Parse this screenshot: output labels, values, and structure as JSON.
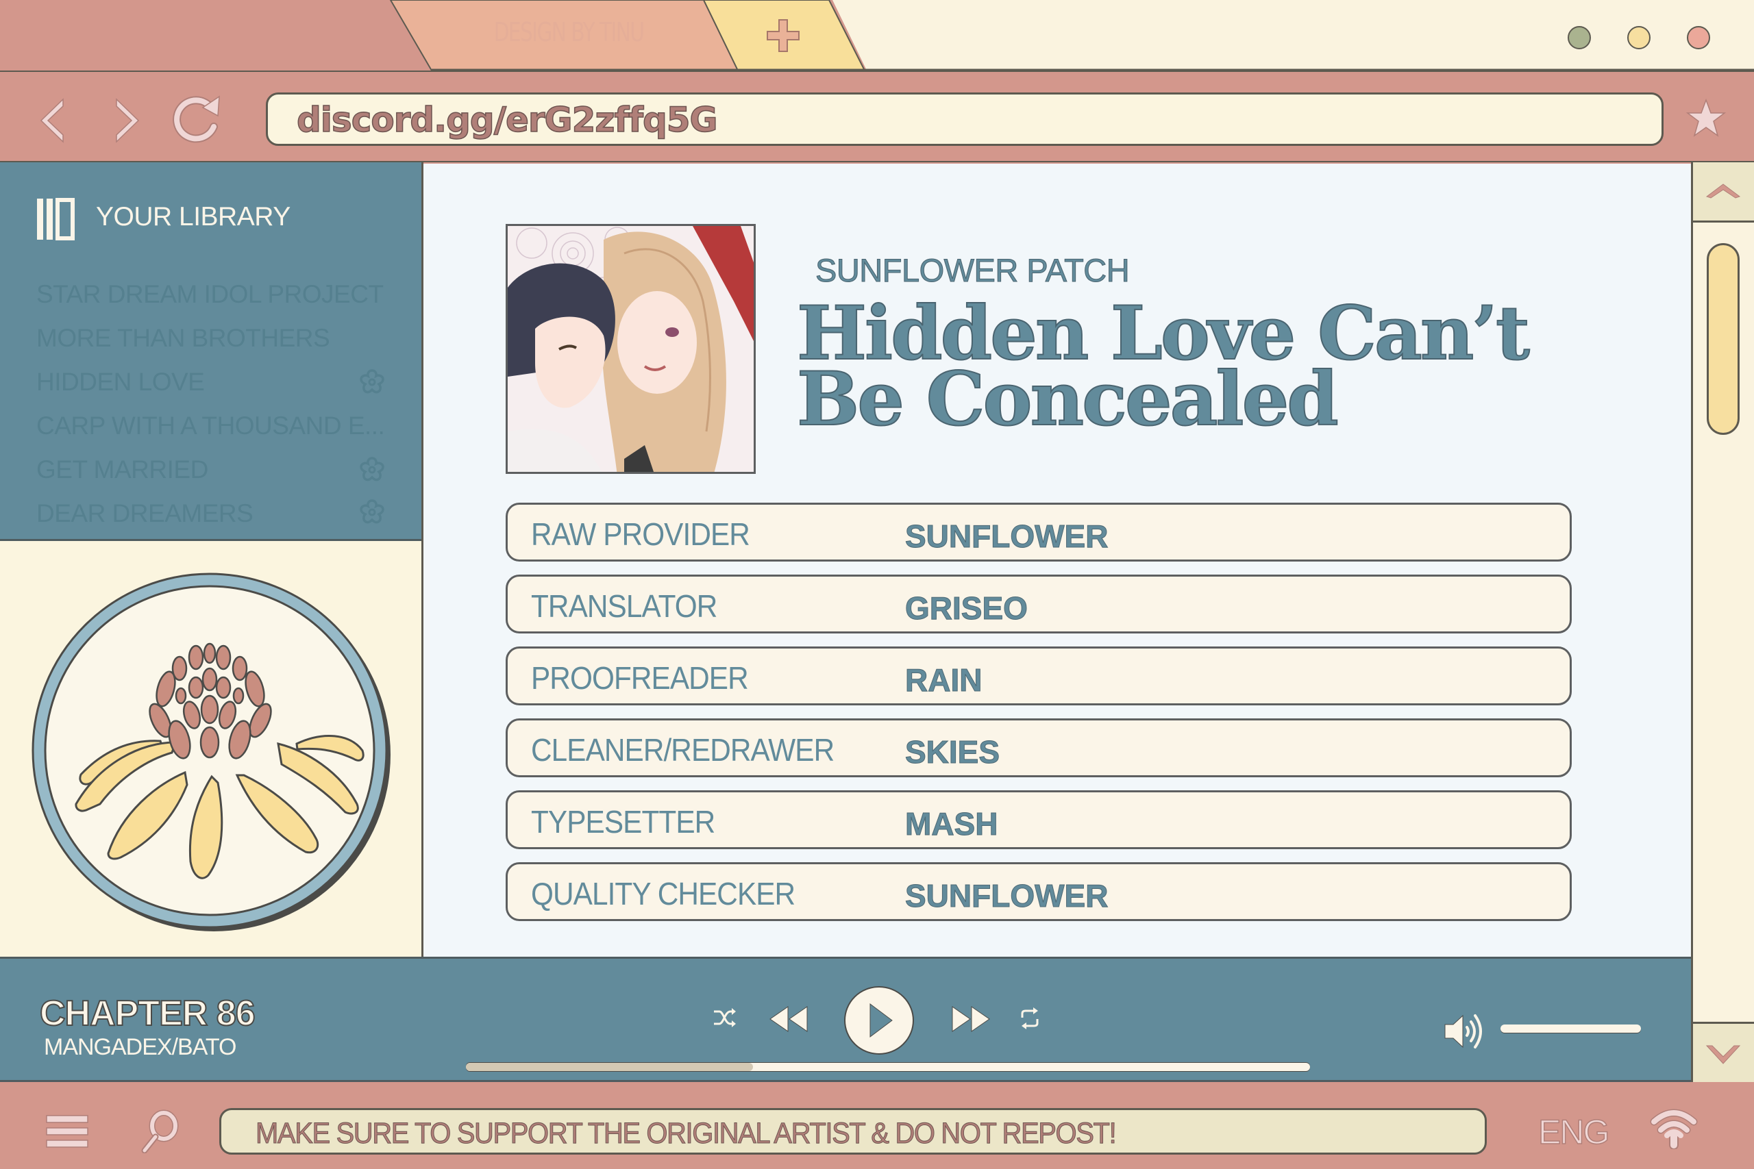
{
  "browser": {
    "tab_label": "DESIGN BY TINU",
    "new_tab_icon": "plus-icon",
    "window_dots": [
      {
        "name": "minimize",
        "color": "#aab38f"
      },
      {
        "name": "maximize",
        "color": "#f7dfa0"
      },
      {
        "name": "close",
        "color": "#eba89a"
      }
    ],
    "nav": {
      "back_icon": "chevron-left-icon",
      "forward_icon": "chevron-right-icon",
      "reload_icon": "reload-icon",
      "bookmark_icon": "star-icon"
    },
    "url": "discord.gg/erG2zffq5G"
  },
  "sidebar": {
    "title": "YOUR LIBRARY",
    "items": [
      {
        "label": "STAR DREAM IDOL PROJECT",
        "flower": false
      },
      {
        "label": "MORE THAN BROTHERS",
        "flower": false
      },
      {
        "label": "HIDDEN LOVE",
        "flower": true
      },
      {
        "label": "CARP WITH A THOUSAND E...",
        "flower": false
      },
      {
        "label": "GET MARRIED",
        "flower": true
      },
      {
        "label": "DEAR DREAMERS",
        "flower": true
      }
    ],
    "logo": "sunflower-logo"
  },
  "content": {
    "group_name": "SUNFLOWER PATCH",
    "title_line1": "Hidden Love Can’t",
    "title_line2": "Be Concealed",
    "credits": [
      {
        "role": "RAW PROVIDER",
        "name": "SUNFLOWER"
      },
      {
        "role": "TRANSLATOR",
        "name": "GRISEO"
      },
      {
        "role": "PROOFREADER",
        "name": "RAIN"
      },
      {
        "role": "CLEANER/REDRAWER",
        "name": "SKIES"
      },
      {
        "role": "TYPESETTER",
        "name": "MASH"
      },
      {
        "role": "QUALITY CHECKER",
        "name": "SUNFLOWER"
      }
    ]
  },
  "player": {
    "chapter": "CHAPTER 86",
    "source": "MANGADEX/BATO",
    "progress_fraction": 0.34,
    "volume_fraction": 1.0
  },
  "taskbar": {
    "notice": "MAKE SURE TO SUPPORT THE ORIGINAL ARTIST & DO NOT REPOST!",
    "language": "ENG"
  },
  "colors": {
    "rose": "#d3978c",
    "teal": "#628b9b",
    "cream": "#fbf5df",
    "yellow": "#f7dfa0",
    "outline": "#5d5a50"
  }
}
